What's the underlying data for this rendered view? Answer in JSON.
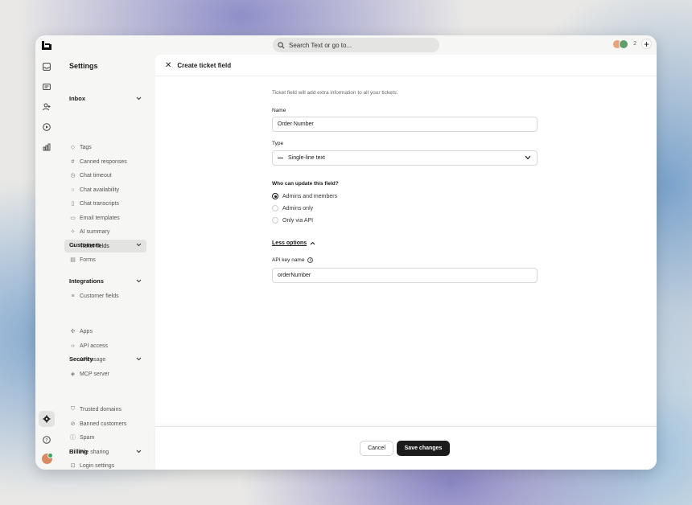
{
  "search": {
    "placeholder": "Search Text or go to..."
  },
  "topbar": {
    "collaborator_count": "2"
  },
  "sidebar": {
    "title": "Settings",
    "sections": [
      {
        "label": "Inbox",
        "items": [
          "Tags",
          "Canned responses",
          "Chat timeout",
          "Chat availability",
          "Chat transcripts",
          "Email templates",
          "AI summary",
          "Ticket fields",
          "Forms"
        ]
      },
      {
        "label": "Customers",
        "items": [
          "Customer fields"
        ]
      },
      {
        "label": "Integrations",
        "items": [
          "Apps",
          "API access",
          "API usage",
          "MCP server"
        ]
      },
      {
        "label": "Security",
        "items": [
          "Trusted domains",
          "Banned customers",
          "Spam",
          "File sharing",
          "Login settings"
        ]
      },
      {
        "label": "Billing",
        "items": []
      }
    ],
    "active_item": "Ticket fields"
  },
  "main": {
    "header_title": "Create ticket field",
    "intro": "Ticket field will add extra information to all your tickets.",
    "name_label": "Name",
    "name_value": "Order Number",
    "type_label": "Type",
    "type_value": "Single-line text",
    "who_label": "Who can update this field?",
    "options": [
      "Admins and members",
      "Admins only",
      "Only via API"
    ],
    "selected_option": "Admins and members",
    "less_options": "Less options",
    "api_key_label": "API key name",
    "api_key_value": "orderNumber"
  },
  "footer": {
    "cancel": "Cancel",
    "save": "Save changes"
  },
  "colors": {
    "primary_button": "#1c1c1c",
    "active_bg": "#e3e3e2",
    "online": "#2fae5a"
  }
}
